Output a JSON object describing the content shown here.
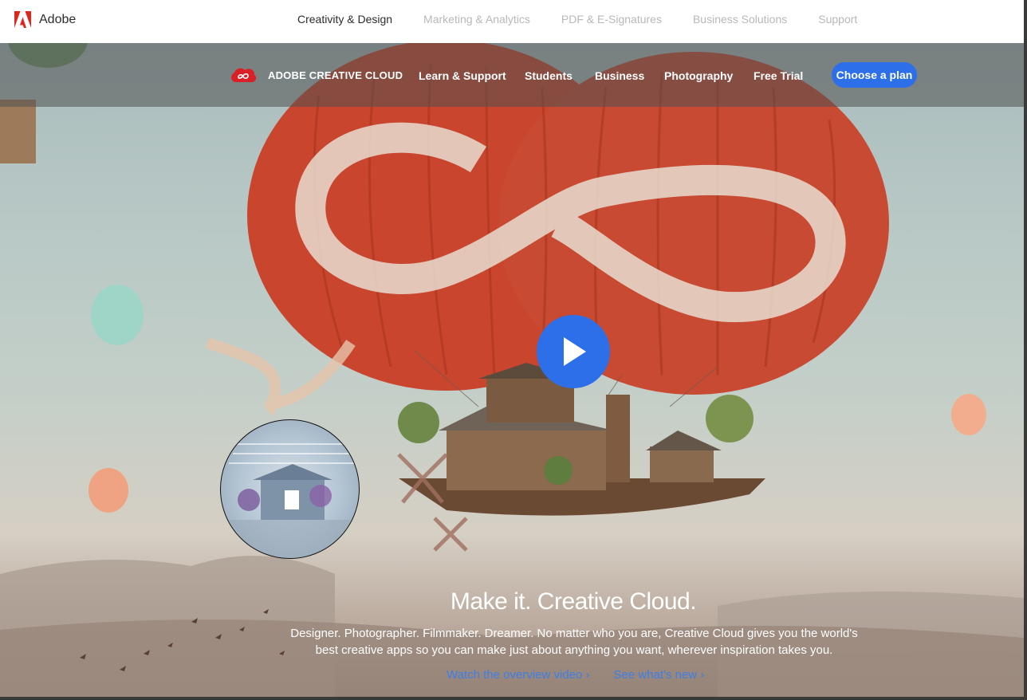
{
  "brand": {
    "name": "Adobe",
    "logo_color": "#e1251b"
  },
  "top_nav": {
    "items": [
      {
        "label": "Creativity & Design",
        "active": true
      },
      {
        "label": "Marketing & Analytics",
        "active": false
      },
      {
        "label": "PDF & E-Signatures",
        "active": false
      },
      {
        "label": "Business Solutions",
        "active": false
      },
      {
        "label": "Support",
        "active": false
      }
    ]
  },
  "sub_nav": {
    "title": "ADOBE CREATIVE CLOUD",
    "items": [
      "Learn & Support",
      "Students",
      "Business",
      "Photography",
      "Free Trial"
    ],
    "cta": "Choose a plan",
    "accent": "#2d6fe8"
  },
  "hero": {
    "headline": "Make it. Creative Cloud.",
    "description": "Designer. Photographer. Filmmaker. Dreamer. No matter who you are, Creative Cloud gives you the world's best creative apps so you can make just about anything you want, wherever inspiration takes you.",
    "links": [
      "Watch the overview video ›",
      "See what's new ›"
    ],
    "link_color": "#3b7fe8"
  }
}
